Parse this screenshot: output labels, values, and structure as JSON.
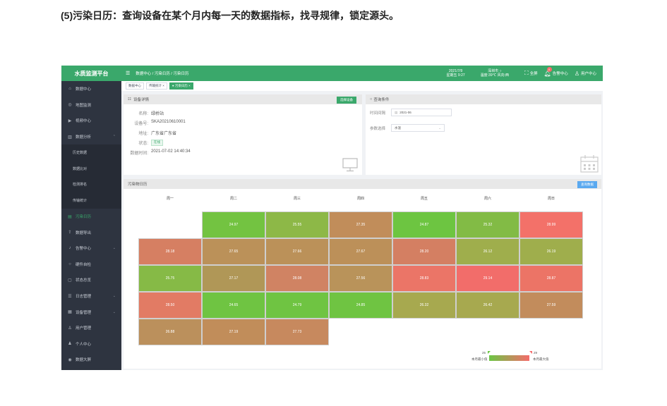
{
  "doc_heading": "(5)污染日历：查询设备在某个月内每一天的数据指标，找寻规律，锁定源头。",
  "sidebar": {
    "brand": "水质监测平台",
    "items": [
      {
        "label": "数据中心",
        "icon": "home-icon"
      },
      {
        "label": "地图监测",
        "icon": "map-icon"
      },
      {
        "label": "视频中心",
        "icon": "video-icon"
      },
      {
        "label": "数据分析",
        "icon": "chart-icon",
        "chevron": "⌃"
      },
      {
        "label": "历史数据",
        "sub": true
      },
      {
        "label": "数据比对",
        "sub": true
      },
      {
        "label": "检测排名",
        "sub": true
      },
      {
        "label": "传输统计",
        "sub": true
      },
      {
        "label": "污染日历",
        "icon": "calendar-icon",
        "active": true
      },
      {
        "label": "数据导出",
        "icon": "export-icon"
      },
      {
        "label": "告警中心",
        "icon": "bell-icon",
        "chevron": "⌄"
      },
      {
        "label": "硬件自检",
        "icon": "check-icon"
      },
      {
        "label": "状态总览",
        "icon": "monitor-icon"
      },
      {
        "label": "日志管理",
        "icon": "log-icon",
        "chevron": "⌄"
      },
      {
        "label": "设备管理",
        "icon": "device-icon",
        "chevron": "⌄"
      },
      {
        "label": "用户管理",
        "icon": "users-icon"
      },
      {
        "label": "个人中心",
        "icon": "person-icon"
      },
      {
        "label": "数据大屏",
        "icon": "screen-icon"
      }
    ]
  },
  "topbar": {
    "breadcrumb": "数据中心 / 污染日历 / 污染日历",
    "date": "2021/7/9",
    "weekday_time": "星期五 9:27",
    "city_weather": "深圳市 ○",
    "temp_wind": "温度:39℃ 风向:西",
    "fullscreen_label": "全屏",
    "alarm_label": "告警中心",
    "alarm_count": "0",
    "user_label": "用户中心"
  },
  "tabs": [
    {
      "label": "数据中心",
      "active": false
    },
    {
      "label": "传输统计 ×",
      "active": false
    },
    {
      "label": "● 污染日历 ×",
      "active": true
    }
  ],
  "device_panel": {
    "title": "设备详情",
    "select_button": "选择设备",
    "name_label": "名称:",
    "name_value": "绿桥站",
    "id_label": "设备号:",
    "id_value": "SKA20210610001",
    "address_label": "地址:",
    "address_value": "广东省广东省",
    "status_label": "状态:",
    "status_value": "在线",
    "time_label": "数据时间:",
    "time_value": "2021-07-02 14:40:34"
  },
  "query_panel": {
    "title": "查询条件",
    "time_label": "时间间隔",
    "time_value": "2021-06",
    "param_label": "参数选择",
    "param_value": "水温"
  },
  "calendar": {
    "title": "污染物日历",
    "query_button": "查询数据",
    "weekdays": [
      "周一",
      "周二",
      "周三",
      "周四",
      "周五",
      "周六",
      "周日"
    ],
    "rows": [
      [
        null,
        "24.97",
        "25.55",
        "27.35",
        "24.87",
        "25.32",
        "28.99"
      ],
      [
        "28.18",
        "27.65",
        "27.66",
        "27.67",
        "28.20",
        "26.12",
        "26.19"
      ],
      [
        "25.75",
        "27.17",
        "28.08",
        "27.56",
        "28.83",
        "29.14",
        "28.87"
      ],
      [
        "28.50",
        "24.65",
        "24.79",
        "24.85",
        "26.32",
        "26.42",
        "27.59"
      ],
      [
        "26.88",
        "27.19",
        "27.73",
        null,
        null,
        null,
        null
      ]
    ],
    "colors": [
      [
        null,
        "#73c341",
        "#8db847",
        "#c18d5a",
        "#6dc541",
        "#82bb45",
        "#f37169"
      ],
      [
        "#d67f62",
        "#bb9159",
        "#bb9159",
        "#bc9059",
        "#d47f62",
        "#9fae4c",
        "#9fae4c"
      ],
      [
        "#86ba46",
        "#b09757",
        "#d08363",
        "#b9935a",
        "#eb7567",
        "#f26d6a",
        "#ec7466"
      ],
      [
        "#e27b64",
        "#6fc442",
        "#6fc442",
        "#6fc442",
        "#a7a94f",
        "#a7a94f",
        "#c28c5c"
      ],
      [
        "#bb905c",
        "#c18d5a",
        "#c7895e",
        null,
        null,
        null,
        null
      ]
    ],
    "legend_min": "25",
    "legend_max": "29",
    "legend_min_label": "本月最小值",
    "legend_max_label": "本月最大值",
    "min_color": "#6cc644",
    "max_color": "#f46b6b"
  }
}
